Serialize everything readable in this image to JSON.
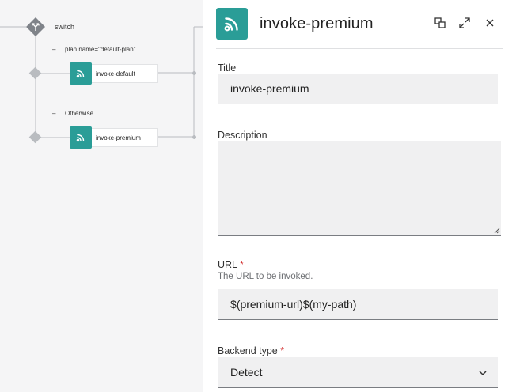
{
  "flow": {
    "switch_label": "switch",
    "conditions": [
      {
        "dash": "–",
        "text": "plan.name=\"default-plan\""
      },
      {
        "dash": "–",
        "text": "Otherwise"
      }
    ],
    "steps": [
      {
        "label": "invoke-default",
        "icon": "rss-icon"
      },
      {
        "label": "invoke-premium",
        "icon": "rss-icon"
      }
    ]
  },
  "panel": {
    "title": "invoke-premium",
    "icon": "rss-icon",
    "actions": [
      "swap-icon",
      "expand-icon",
      "close-icon"
    ],
    "fields": {
      "title": {
        "label": "Title",
        "value": "invoke-premium"
      },
      "description": {
        "label": "Description",
        "value": ""
      },
      "url": {
        "label": "URL",
        "required": "*",
        "hint": "The URL to be invoked.",
        "value": "$(premium-url)$(my-path)"
      },
      "backend_type": {
        "label": "Backend type",
        "required": "*",
        "value": "Detect"
      }
    }
  },
  "colors": {
    "accent": "#2a9d97",
    "required": "#d32f2f",
    "connector": "#b9bcc0"
  }
}
